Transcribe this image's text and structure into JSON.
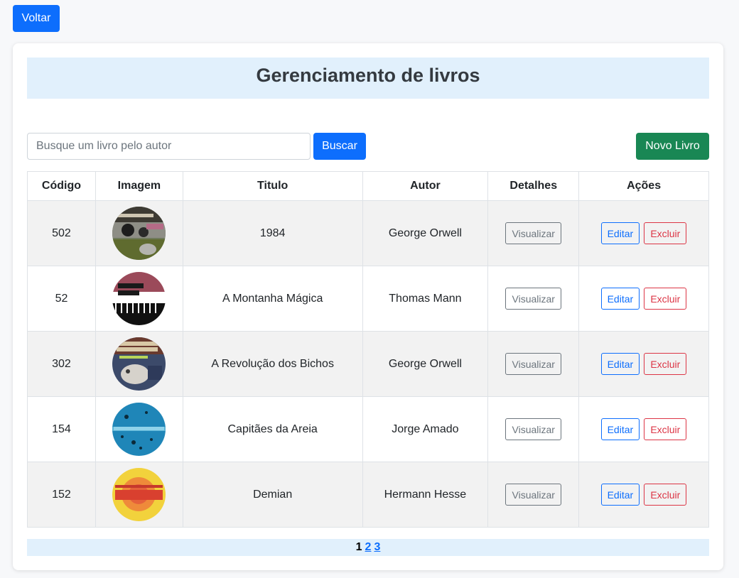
{
  "back_button": "Voltar",
  "page_title": "Gerenciamento de livros",
  "search": {
    "placeholder": "Busque um livro pelo autor",
    "value": "",
    "button": "Buscar"
  },
  "new_button": "Novo Livro",
  "table": {
    "headers": [
      "Código",
      "Imagem",
      "Titulo",
      "Autor",
      "Detalhes",
      "Ações"
    ],
    "rows": [
      {
        "code": "502",
        "title": "1984",
        "author": "George Orwell",
        "view": "Visualizar",
        "edit": "Editar",
        "delete": "Excluir",
        "cover_icon": "book-cover-1984-icon"
      },
      {
        "code": "52",
        "title": "A Montanha Mágica",
        "author": "Thomas Mann",
        "view": "Visualizar",
        "edit": "Editar",
        "delete": "Excluir",
        "cover_icon": "book-cover-montanha-icon"
      },
      {
        "code": "302",
        "title": "A Revolução dos Bichos",
        "author": "George Orwell",
        "view": "Visualizar",
        "edit": "Editar",
        "delete": "Excluir",
        "cover_icon": "book-cover-bichos-icon"
      },
      {
        "code": "154",
        "title": "Capitães da Areia",
        "author": "Jorge Amado",
        "view": "Visualizar",
        "edit": "Editar",
        "delete": "Excluir",
        "cover_icon": "book-cover-capitaes-icon"
      },
      {
        "code": "152",
        "title": "Demian",
        "author": "Hermann Hesse",
        "view": "Visualizar",
        "edit": "Editar",
        "delete": "Excluir",
        "cover_icon": "book-cover-demian-icon"
      }
    ]
  },
  "pagination": {
    "current": "1",
    "pages": [
      "2",
      "3"
    ]
  },
  "colors": {
    "primary": "#0d6efd",
    "success": "#198754",
    "danger": "#dc3545",
    "secondary": "#6c757d",
    "title_band": "#e1f0fc"
  }
}
